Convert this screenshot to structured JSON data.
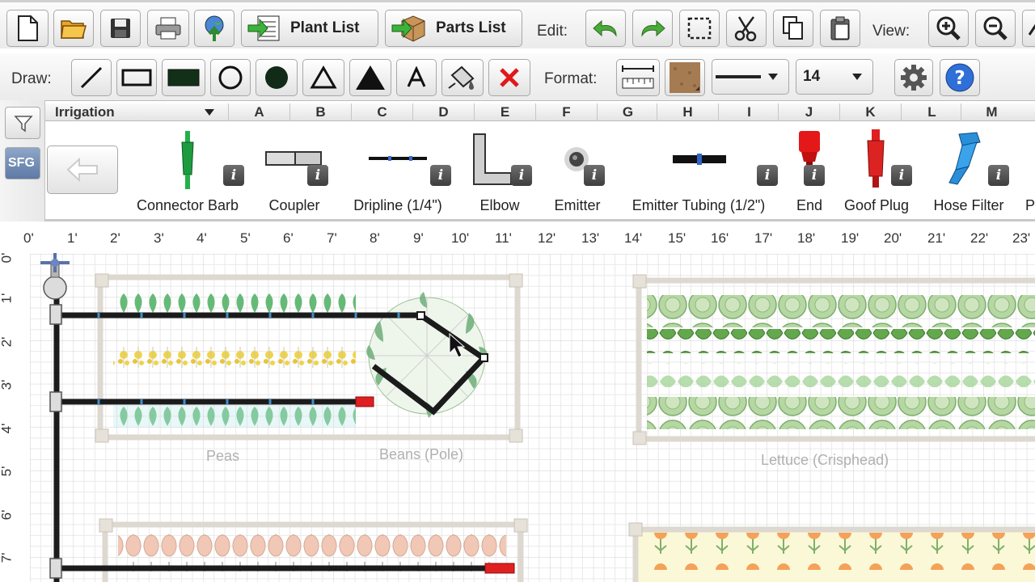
{
  "toolbar": {
    "plant_list_label": "Plant List",
    "parts_list_label": "Parts List",
    "edit_label": "Edit:",
    "view_label": "View:",
    "draw_label": "Draw:",
    "format_label": "Format:",
    "font_size_value": "14"
  },
  "palette": {
    "category": "Irrigation",
    "columns": [
      "A",
      "B",
      "C",
      "D",
      "E",
      "F",
      "G",
      "H",
      "I",
      "J",
      "K",
      "L",
      "M"
    ],
    "sfg_label": "SFG",
    "parts": [
      {
        "name": "Connector Barb"
      },
      {
        "name": "Coupler"
      },
      {
        "name": "Dripline (1/4\")"
      },
      {
        "name": "Elbow"
      },
      {
        "name": "Emitter"
      },
      {
        "name": "Emitter Tubing (1/2\")"
      },
      {
        "name": "End"
      },
      {
        "name": "Goof Plug"
      },
      {
        "name": "Hose Filter"
      },
      {
        "name": "P"
      }
    ]
  },
  "rulers": {
    "top": [
      "0'",
      "1'",
      "2'",
      "3'",
      "4'",
      "5'",
      "6'",
      "7'",
      "8'",
      "9'",
      "10'",
      "11'",
      "12'",
      "13'",
      "14'",
      "15'",
      "16'",
      "17'",
      "18'",
      "19'",
      "20'",
      "21'",
      "22'",
      "23'"
    ],
    "left": [
      "0'",
      "1'",
      "2'",
      "3'",
      "4'",
      "5'",
      "6'",
      "7'"
    ]
  },
  "beds": {
    "peas_label": "Peas",
    "beans_label": "Beans (Pole)",
    "lettuce_label": "Lettuce (Crisphead)"
  },
  "colors": {
    "accent_blue": "#2f6fd8",
    "pipe": "#1b1b1b",
    "end_cap": "#e02020",
    "lettuce": "#9cc98c",
    "grid": "#dcdcdc"
  }
}
